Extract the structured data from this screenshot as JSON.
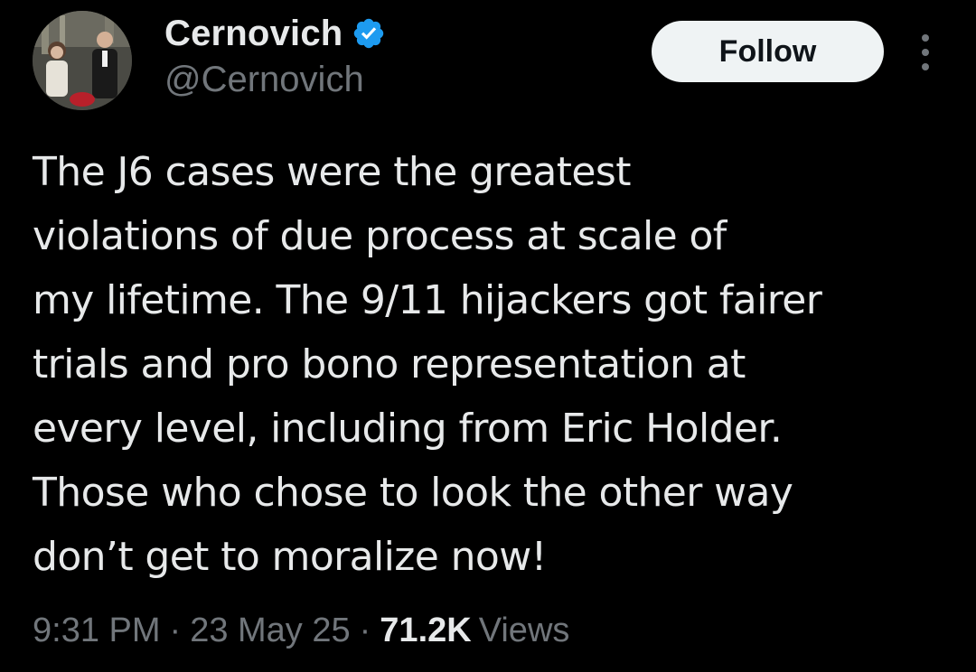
{
  "author": {
    "name": "Cernovich",
    "handle": "@Cernovich",
    "verified": true,
    "verified_color": "#1d9bf0"
  },
  "actions": {
    "follow_label": "Follow",
    "more_icon": "more-vertical-icon"
  },
  "tweet": {
    "lines": [
      "The J6 cases were the greatest",
      "violations of due process at scale of",
      "my lifetime. The 9/11 hijackers got fairer",
      "trials and pro bono representation at",
      "every level, including from Eric Holder.",
      "Those who chose to look the other way",
      "don’t get to moralize now!"
    ]
  },
  "meta": {
    "time": "9:31 PM",
    "separator": "·",
    "date": "23 May 25",
    "views_count": "71.2K",
    "views_label": "Views"
  },
  "colors": {
    "background": "#000000",
    "text": "#e7e9ea",
    "secondary": "#71767b",
    "follow_bg": "#eff3f4",
    "follow_text": "#0f1419"
  }
}
